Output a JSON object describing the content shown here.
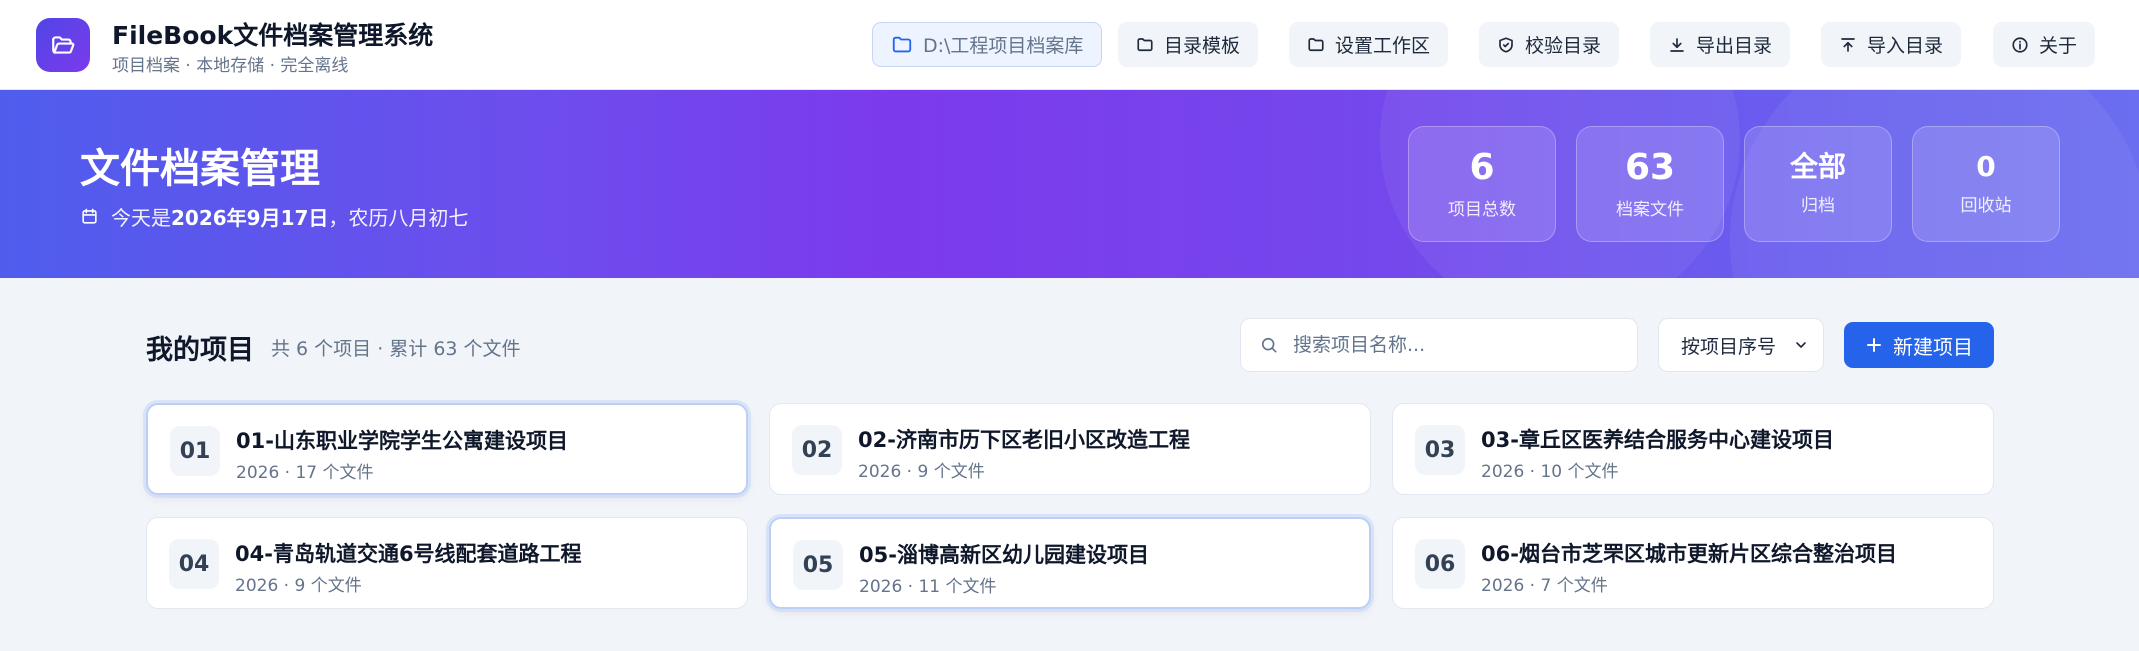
{
  "app": {
    "title": "FileBook文件档案管理系统",
    "subtitle": "项目档案 · 本地存储 · 完全离线"
  },
  "toolbar": {
    "path": "D:\\工程项目档案库",
    "buttons": [
      {
        "label": "目录模板",
        "icon": "folder-icon"
      },
      {
        "label": "设置工作区",
        "icon": "folder-icon"
      },
      {
        "label": "校验目录",
        "icon": "shield-check-icon"
      },
      {
        "label": "导出目录",
        "icon": "download-icon"
      },
      {
        "label": "导入目录",
        "icon": "upload-icon"
      },
      {
        "label": "关于",
        "icon": "info-icon"
      }
    ]
  },
  "hero": {
    "title": "文件档案管理",
    "date_prefix": "今天是",
    "date": "2026年9月17日",
    "date_suffix": "，农历八月初七",
    "stats": [
      {
        "value": "6",
        "label": "项目总数"
      },
      {
        "value": "63",
        "label": "档案文件"
      },
      {
        "value": "全部",
        "label": "归档"
      },
      {
        "value": "0",
        "label": "回收站"
      }
    ]
  },
  "projects_section": {
    "title": "我的项目",
    "meta": "共 6 个项目 · 累计 63 个文件",
    "search_placeholder": "搜索项目名称...",
    "sort_selected": "按项目序号",
    "new_button": "新建项目"
  },
  "projects": [
    {
      "num": "01",
      "name": "01-山东职业学院学生公寓建设项目",
      "meta": "2026 · 17 个文件",
      "selected": true
    },
    {
      "num": "02",
      "name": "02-济南市历下区老旧小区改造工程",
      "meta": "2026 · 9 个文件",
      "selected": false
    },
    {
      "num": "03",
      "name": "03-章丘区医养结合服务中心建设项目",
      "meta": "2026 · 10 个文件",
      "selected": false
    },
    {
      "num": "04",
      "name": "04-青岛轨道交通6号线配套道路工程",
      "meta": "2026 · 9 个文件",
      "selected": false
    },
    {
      "num": "05",
      "name": "05-淄博高新区幼儿园建设项目",
      "meta": "2026 · 11 个文件",
      "selected": true
    },
    {
      "num": "06",
      "name": "06-烟台市芝罘区城市更新片区综合整治项目",
      "meta": "2026 · 7 个文件",
      "selected": false
    }
  ],
  "colors": {
    "accent": "#2563eb",
    "brand_start": "#4f46e5",
    "brand_end": "#7c3aed"
  }
}
